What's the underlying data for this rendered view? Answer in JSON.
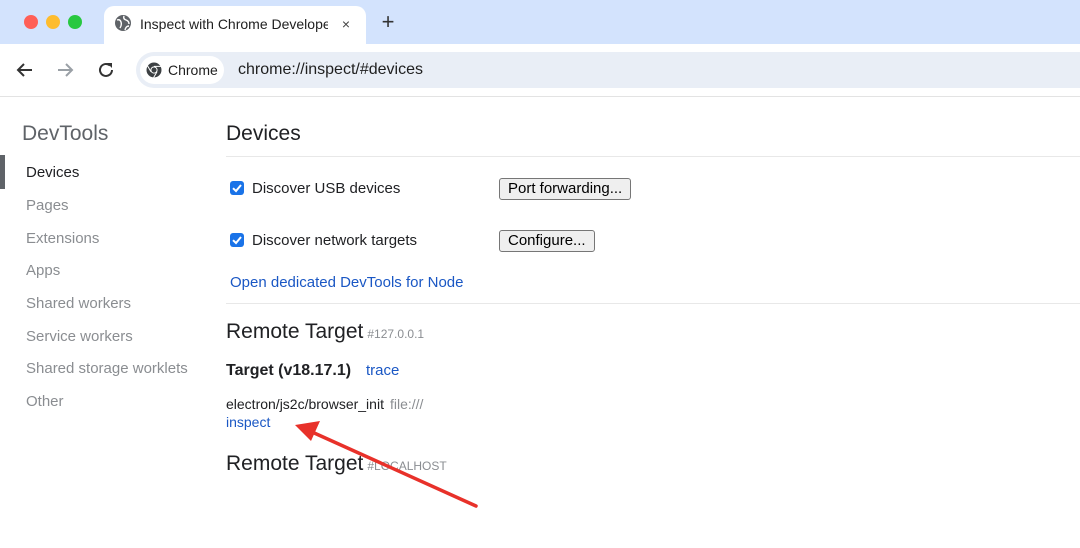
{
  "browser": {
    "tab_title": "Inspect with Chrome Developer Tools",
    "tab_close": "×",
    "new_tab": "+",
    "chip_label": "Chrome",
    "url": "chrome://inspect/#devices"
  },
  "sidebar": {
    "title": "DevTools",
    "items": [
      {
        "label": "Devices",
        "active": true
      },
      {
        "label": "Pages"
      },
      {
        "label": "Extensions"
      },
      {
        "label": "Apps"
      },
      {
        "label": "Shared workers"
      },
      {
        "label": "Service workers"
      },
      {
        "label": "Shared storage worklets"
      },
      {
        "label": "Other"
      }
    ]
  },
  "main": {
    "title": "Devices",
    "discover_usb": {
      "label": "Discover USB devices",
      "checked": true
    },
    "port_forwarding_button": "Port forwarding...",
    "discover_network": {
      "label": "Discover network targets",
      "checked": true
    },
    "configure_button": "Configure...",
    "open_node_link": "Open dedicated DevTools for Node",
    "remote_targets": [
      {
        "title": "Remote Target",
        "host": "#127.0.0.1",
        "target_name": "Target (v18.17.1)",
        "trace_link": "trace",
        "page_url": "electron/js2c/browser_init",
        "page_file": "file:///",
        "inspect_link": "inspect"
      },
      {
        "title": "Remote Target",
        "host": "#LOCALHOST"
      }
    ]
  },
  "colors": {
    "annotation_arrow": "#e8312a",
    "link": "#1a57c4",
    "checkbox": "#1a73e8",
    "tabbar": "#d3e3fd"
  }
}
